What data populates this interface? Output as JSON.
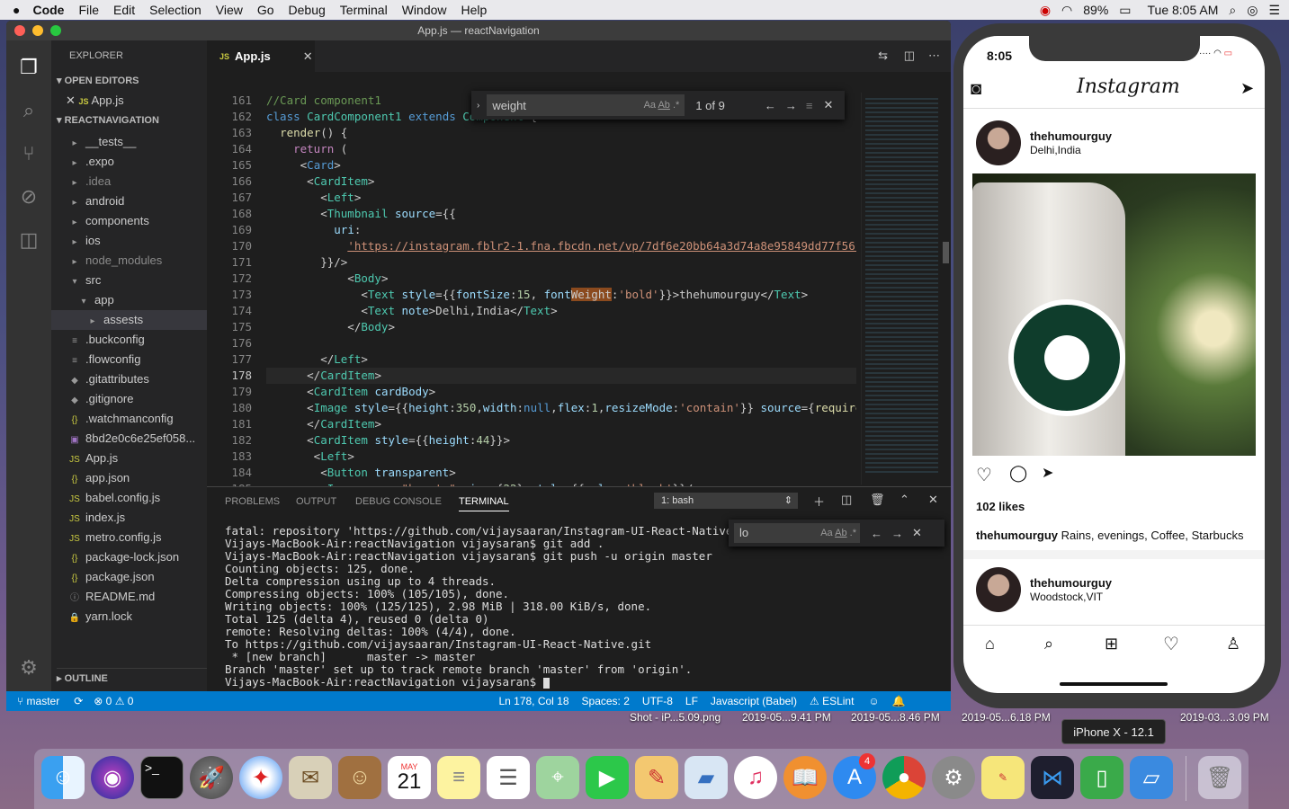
{
  "menubar": {
    "app": "Code",
    "items": [
      "File",
      "Edit",
      "Selection",
      "View",
      "Go",
      "Debug",
      "Terminal",
      "Window",
      "Help"
    ],
    "battery": "89%",
    "clock": "Tue 8:05 AM"
  },
  "window": {
    "title": "App.js — reactNavigation"
  },
  "explorer": {
    "title": "EXPLORER",
    "open_editors": "OPEN EDITORS",
    "open_file": "App.js",
    "project": "REACTNAVIGATION",
    "outline": "OUTLINE",
    "items": [
      {
        "label": "__tests__",
        "icon": "▸",
        "indent": 0
      },
      {
        "label": ".expo",
        "icon": "▸",
        "indent": 0
      },
      {
        "label": ".idea",
        "icon": "▸",
        "indent": 0
      },
      {
        "label": "android",
        "icon": "▸",
        "indent": 0
      },
      {
        "label": "components",
        "icon": "▸",
        "indent": 0
      },
      {
        "label": "ios",
        "icon": "▸",
        "indent": 0
      },
      {
        "label": "node_modules",
        "icon": "▸",
        "indent": 0
      },
      {
        "label": "src",
        "icon": "▾",
        "indent": 0
      },
      {
        "label": "app",
        "icon": "▾",
        "indent": 1
      },
      {
        "label": "assests",
        "icon": "▸",
        "indent": 2
      },
      {
        "label": ".buckconfig",
        "icon": "≡",
        "indent": 0
      },
      {
        "label": ".flowconfig",
        "icon": "≡",
        "indent": 0
      },
      {
        "label": ".gitattributes",
        "icon": "◆",
        "indent": 0
      },
      {
        "label": ".gitignore",
        "icon": "◆",
        "indent": 0
      },
      {
        "label": ".watchmanconfig",
        "icon": "{}",
        "indent": 0
      },
      {
        "label": "8bd2e0c6e25ef058...",
        "icon": "▣",
        "indent": 0
      },
      {
        "label": "App.js",
        "icon": "JS",
        "indent": 0
      },
      {
        "label": "app.json",
        "icon": "{}",
        "indent": 0
      },
      {
        "label": "babel.config.js",
        "icon": "JS",
        "indent": 0
      },
      {
        "label": "index.js",
        "icon": "JS",
        "indent": 0
      },
      {
        "label": "metro.config.js",
        "icon": "JS",
        "indent": 0
      },
      {
        "label": "package-lock.json",
        "icon": "{}",
        "indent": 0
      },
      {
        "label": "package.json",
        "icon": "{}",
        "indent": 0
      },
      {
        "label": "README.md",
        "icon": "ⓘ",
        "indent": 0
      },
      {
        "label": "yarn.lock",
        "icon": "🔒",
        "indent": 0
      }
    ]
  },
  "editor": {
    "tab": "App.js",
    "find": {
      "query": "weight",
      "count": "1 of 9"
    },
    "line_numbers": [
      "161",
      "162",
      "163",
      "164",
      "165",
      "166",
      "167",
      "168",
      "169",
      "170",
      "171",
      "172",
      "173",
      "174",
      "175",
      "176",
      "177",
      "178",
      "179",
      "180",
      "181",
      "182",
      "183",
      "184",
      "185"
    ]
  },
  "panel": {
    "tabs": [
      "PROBLEMS",
      "OUTPUT",
      "DEBUG CONSOLE",
      "TERMINAL"
    ],
    "shell": "1: bash",
    "find": "lo",
    "lines": [
      "fatal: repository 'https://github.com/vijaysaaran/Instagram-UI-React-Native.git/",
      "Vijays-MacBook-Air:reactNavigation vijaysaran$ git add .",
      "Vijays-MacBook-Air:reactNavigation vijaysaran$ git push -u origin master",
      "Counting objects: 125, done.",
      "Delta compression using up to 4 threads.",
      "Compressing objects: 100% (105/105), done.",
      "Writing objects: 100% (125/125), 2.98 MiB | 318.00 KiB/s, done.",
      "Total 125 (delta 4), reused 0 (delta 0)",
      "remote: Resolving deltas: 100% (4/4), done.",
      "To https://github.com/vijaysaaran/Instagram-UI-React-Native.git",
      " * [new branch]      master -> master",
      "Branch 'master' set up to track remote branch 'master' from 'origin'.",
      "Vijays-MacBook-Air:reactNavigation vijaysaran$ "
    ]
  },
  "status": {
    "branch": "master",
    "errors": "⊗ 0 ⚠ 0",
    "position": "Ln 178, Col 18",
    "spaces": "Spaces: 2",
    "encoding": "UTF-8",
    "eol": "LF",
    "language": "Javascript (Babel)",
    "eslint": "ESLint"
  },
  "phone": {
    "time": "8:05",
    "logo": "Instagram",
    "post1": {
      "user": "thehumourguy",
      "location": "Delhi,India",
      "likes": "102 likes",
      "caption_user": "thehumourguy",
      "caption": "Rains, evenings, Coffee, Starbucks"
    },
    "post2": {
      "user": "thehumourguy",
      "location": "Woodstock,VIT"
    },
    "device": "iPhone X - 12.1"
  },
  "desktop": {
    "labels": [
      "Shot - iP...5.09.png",
      "2019-05...9.41 PM",
      "2019-05...8.46 PM",
      "2019-05...6.18 PM",
      "2019-03...3.09 PM"
    ]
  },
  "dock": {
    "calendar_month": "MAY",
    "calendar_day": "21",
    "appstore_badge": "4"
  }
}
